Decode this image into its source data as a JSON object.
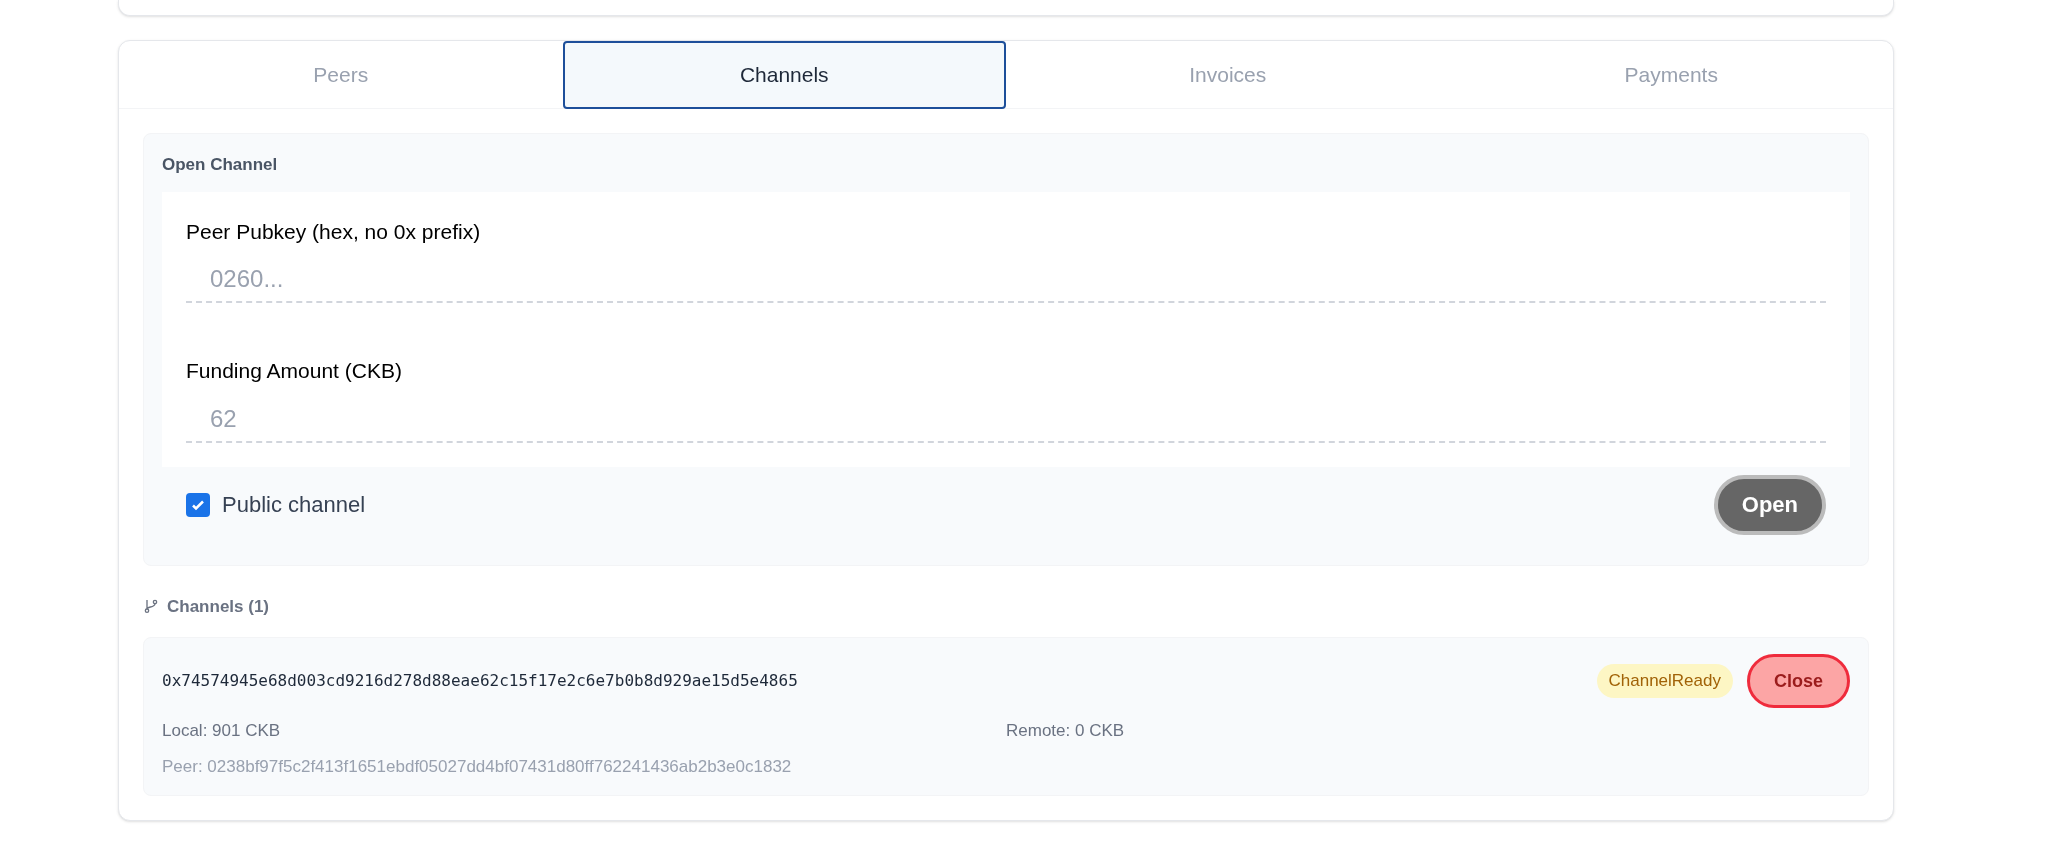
{
  "tabs": [
    {
      "label": "Peers",
      "selected": false
    },
    {
      "label": "Channels",
      "selected": true
    },
    {
      "label": "Invoices",
      "selected": false
    },
    {
      "label": "Payments",
      "selected": false
    }
  ],
  "open_channel": {
    "title": "Open Channel",
    "fields": [
      {
        "label": "Peer Pubkey (hex, no 0x prefix)",
        "placeholder": "0260..."
      },
      {
        "label": "Funding Amount (CKB)",
        "placeholder": "62"
      }
    ],
    "public_channel": {
      "label": "Public channel",
      "checked": true
    },
    "open_button": "Open"
  },
  "channels_header": "Channels (1)",
  "channels": [
    {
      "id": "0x74574945e68d003cd9216d278d88eae62c15f17e2c6e7b0b8d929ae15d5e4865",
      "state": "ChannelReady",
      "close_button": "Close",
      "local": "Local: 901 CKB",
      "remote": "Remote: 0 CKB",
      "peer": "Peer: 0238bf97f5c2f413f1651ebdf05027dd4bf07431d80ff762241436ab2b3e0c1832"
    }
  ]
}
